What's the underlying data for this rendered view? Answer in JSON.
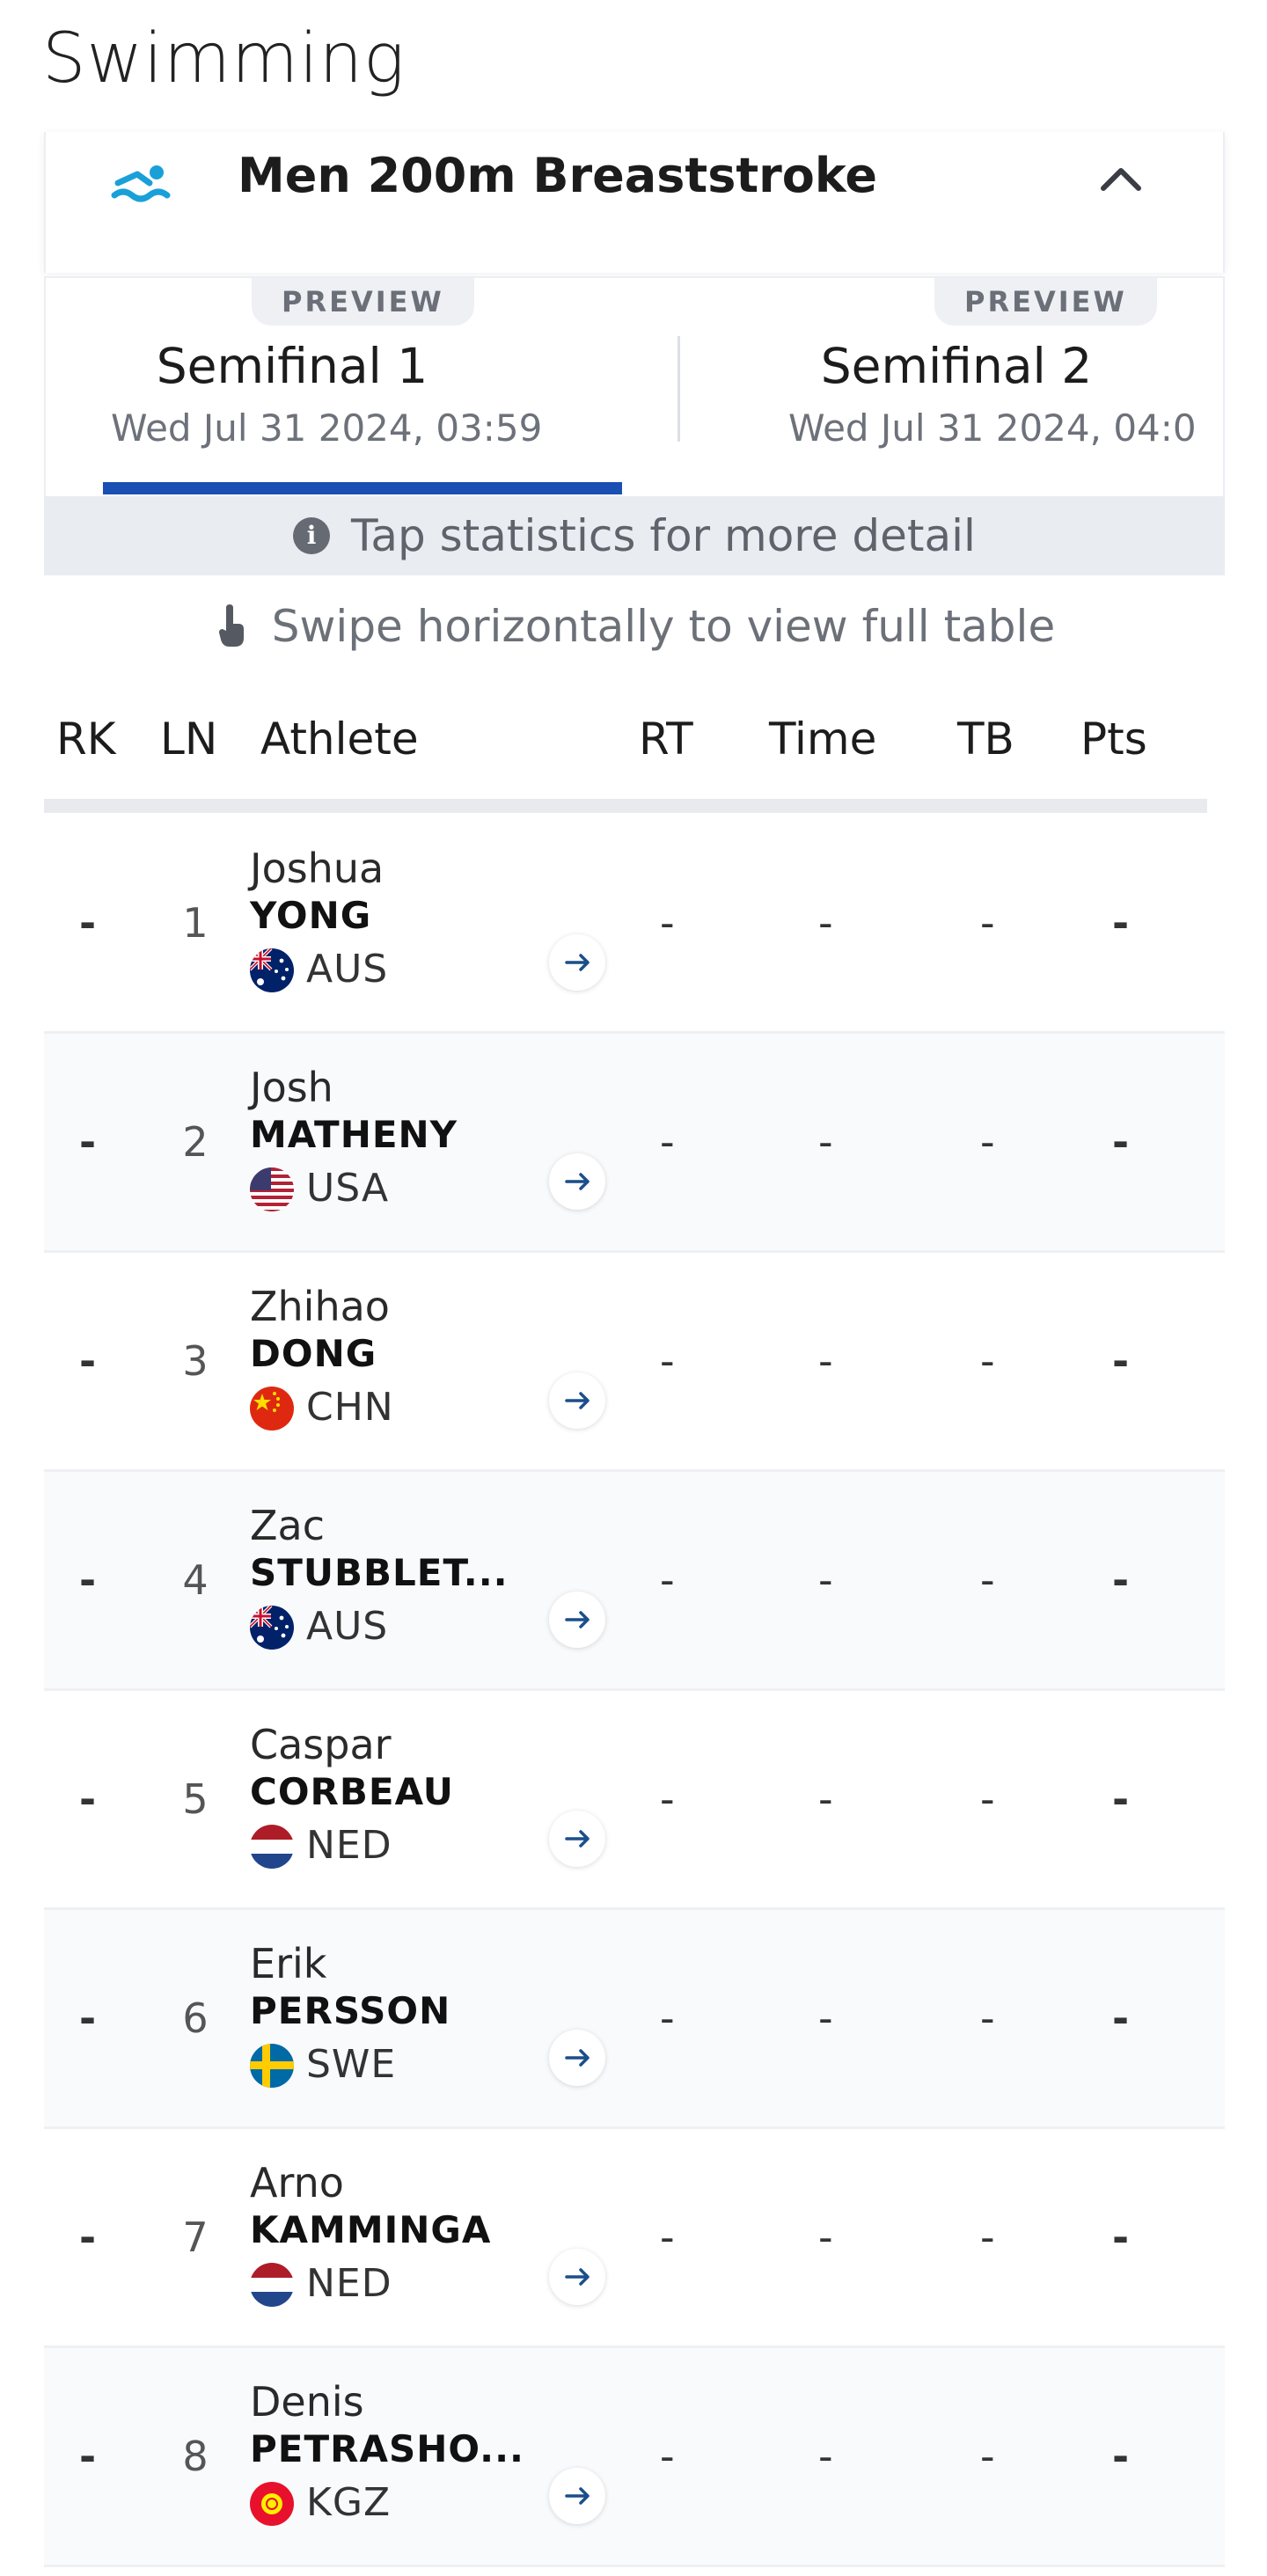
{
  "sport_title": "Swimming",
  "event": {
    "name": "Men 200m Breaststroke",
    "icon": "swimmer-icon",
    "collapse_icon": "chevron-up-icon"
  },
  "tabs": [
    {
      "badge": "PREVIEW",
      "name": "Semifinal 1",
      "date": "Wed Jul 31 2024, 03:59",
      "selected": true
    },
    {
      "badge": "PREVIEW",
      "name": "Semifinal 2",
      "date": "Wed Jul 31 2024, 04:0",
      "selected": false
    }
  ],
  "info_bar": {
    "icon": "info-icon",
    "text": "Tap statistics for more detail"
  },
  "swipe_hint": {
    "icon": "swipe-hand-icon",
    "text": "Swipe horizontally to view full table"
  },
  "columns": {
    "rk": "RK",
    "ln": "LN",
    "athlete": "Athlete",
    "rt": "RT",
    "time": "Time",
    "tb": "TB",
    "pts": "Pts"
  },
  "rows": [
    {
      "rk": "-",
      "ln": "1",
      "first": "Joshua",
      "last": "YONG",
      "noc": "AUS",
      "rt": "-",
      "time": "-",
      "tb": "-",
      "pts": "-"
    },
    {
      "rk": "-",
      "ln": "2",
      "first": "Josh",
      "last": "MATHENY",
      "noc": "USA",
      "rt": "-",
      "time": "-",
      "tb": "-",
      "pts": "-"
    },
    {
      "rk": "-",
      "ln": "3",
      "first": "Zhihao",
      "last": "DONG",
      "noc": "CHN",
      "rt": "-",
      "time": "-",
      "tb": "-",
      "pts": "-"
    },
    {
      "rk": "-",
      "ln": "4",
      "first": "Zac",
      "last": "STUBBLET...",
      "noc": "AUS",
      "rt": "-",
      "time": "-",
      "tb": "-",
      "pts": "-"
    },
    {
      "rk": "-",
      "ln": "5",
      "first": "Caspar",
      "last": "CORBEAU",
      "noc": "NED",
      "rt": "-",
      "time": "-",
      "tb": "-",
      "pts": "-"
    },
    {
      "rk": "-",
      "ln": "6",
      "first": "Erik",
      "last": "PERSSON",
      "noc": "SWE",
      "rt": "-",
      "time": "-",
      "tb": "-",
      "pts": "-"
    },
    {
      "rk": "-",
      "ln": "7",
      "first": "Arno",
      "last": "KAMMINGA",
      "noc": "NED",
      "rt": "-",
      "time": "-",
      "tb": "-",
      "pts": "-"
    },
    {
      "rk": "-",
      "ln": "8",
      "first": "Denis",
      "last": "PETRASHO...",
      "noc": "KGZ",
      "rt": "-",
      "time": "-",
      "tb": "-",
      "pts": "-"
    }
  ],
  "colors": {
    "accent": "#1a4fb4",
    "icon_teal": "#1aa0d8",
    "info_bg": "#e9ecf1"
  }
}
